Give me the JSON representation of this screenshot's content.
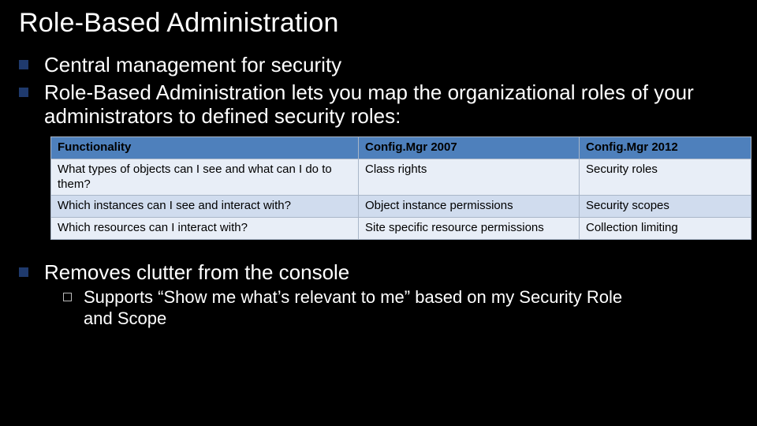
{
  "title": "Role-Based Administration",
  "bullets": {
    "b1": "Central management for security",
    "b2": "Role-Based Administration lets you map the organizational roles of your administrators to defined security roles:",
    "b3": "Removes clutter from the console",
    "sub1_prefix": "Supports “",
    "sub1_quote": "Show me what’s relevant to me",
    "sub1_suffix": "” based on my Security Role and Scope"
  },
  "chart_data": {
    "type": "table",
    "headers": [
      "Functionality",
      "Config.Mgr 2007",
      "Config.Mgr 2012"
    ],
    "rows": [
      [
        "What types of objects can I see and what can I do to them?",
        "Class rights",
        "Security roles"
      ],
      [
        "Which instances can I see and interact with?",
        "Object instance permissions",
        "Security scopes"
      ],
      [
        "Which resources can I interact with?",
        "Site specific resource permissions",
        "Collection limiting"
      ]
    ]
  }
}
